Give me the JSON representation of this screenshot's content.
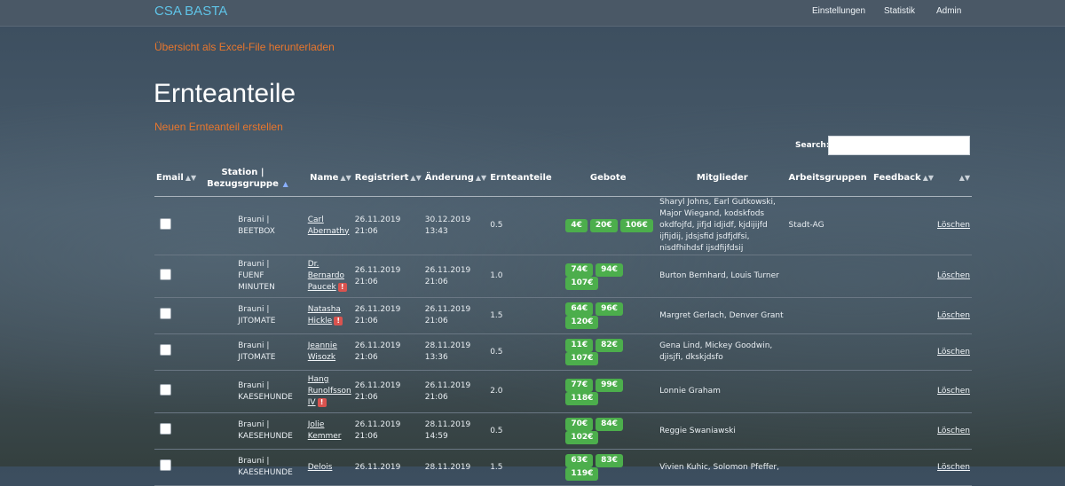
{
  "navbar": {
    "brand": "CSA BASTA",
    "links": [
      "Einstellungen",
      "Statistik",
      "Admin"
    ]
  },
  "excel_link": "Übersicht als Excel-File herunterladen",
  "page_title": "Ernteanteile",
  "create_link": "Neuen Ernteanteil erstellen",
  "search": {
    "label": "Search:",
    "value": ""
  },
  "table": {
    "headers": {
      "email": "Email",
      "station_line1": "Station |",
      "station_line2": "Bezugsgruppe",
      "name": "Name",
      "registriert": "Registriert",
      "aenderung": "Änderung",
      "ernteanteile": "Ernteanteile",
      "gebote": "Gebote",
      "mitglieder": "Mitglieder",
      "arbeitsgruppen": "Arbeitsgruppen",
      "feedback": "Feedback"
    },
    "rows": [
      {
        "station": "Brauni | BEETBOX",
        "name_lines": [
          "Carl",
          "Abernathy"
        ],
        "warning": false,
        "registriert": [
          "26.11.2019",
          "21:06"
        ],
        "aenderung": [
          "30.12.2019",
          "13:43"
        ],
        "ernteanteile": "0.5",
        "gebote": [
          "4€",
          "20€",
          "106€"
        ],
        "mitglieder": "Sharyl Johns, Earl Gutkowski, Major Wiegand, kodskfods okdfojfd, jifjd idjidf, kjdijijfd ijfijdij, jdsjsfid jsdfjdfsi, nisdfhihdsf ijsdfijfdsij",
        "arbeitsgruppen": "Stadt-AG",
        "feedback": "",
        "action": "Löschen"
      },
      {
        "station": "Brauni | FUENF MINUTEN",
        "name_lines": [
          "Dr.",
          "Bernardo",
          "Paucek"
        ],
        "warning": true,
        "registriert": [
          "26.11.2019",
          "21:06"
        ],
        "aenderung": [
          "26.11.2019",
          "21:06"
        ],
        "ernteanteile": "1.0",
        "gebote": [
          "74€",
          "94€",
          "107€"
        ],
        "mitglieder": "Burton Bernhard, Louis Turner",
        "arbeitsgruppen": "",
        "feedback": "",
        "action": "Löschen"
      },
      {
        "station": "Brauni | JITOMATE",
        "name_lines": [
          "Natasha",
          "Hickle"
        ],
        "warning": true,
        "registriert": [
          "26.11.2019",
          "21:06"
        ],
        "aenderung": [
          "26.11.2019",
          "21:06"
        ],
        "ernteanteile": "1.5",
        "gebote": [
          "64€",
          "96€",
          "120€"
        ],
        "mitglieder": "Margret Gerlach, Denver Grant",
        "arbeitsgruppen": "",
        "feedback": "",
        "action": "Löschen"
      },
      {
        "station": "Brauni | JITOMATE",
        "name_lines": [
          "Jeannie",
          "Wisozk"
        ],
        "warning": false,
        "registriert": [
          "26.11.2019",
          "21:06"
        ],
        "aenderung": [
          "28.11.2019",
          "13:36"
        ],
        "ernteanteile": "0.5",
        "gebote": [
          "11€",
          "82€",
          "107€"
        ],
        "mitglieder": "Gena Lind, Mickey Goodwin, djisjfi, dkskjdsfo",
        "arbeitsgruppen": "",
        "feedback": "",
        "action": "Löschen"
      },
      {
        "station": "Brauni | KAESEHUNDE",
        "name_lines": [
          "Hang",
          "Runolfsson",
          "IV"
        ],
        "warning": true,
        "registriert": [
          "26.11.2019",
          "21:06"
        ],
        "aenderung": [
          "26.11.2019",
          "21:06"
        ],
        "ernteanteile": "2.0",
        "gebote": [
          "77€",
          "99€",
          "118€"
        ],
        "mitglieder": "Lonnie Graham",
        "arbeitsgruppen": "",
        "feedback": "",
        "action": "Löschen"
      },
      {
        "station": "Brauni | KAESEHUNDE",
        "name_lines": [
          "Jolie",
          "Kemmer"
        ],
        "warning": false,
        "registriert": [
          "26.11.2019",
          "21:06"
        ],
        "aenderung": [
          "28.11.2019",
          "14:59"
        ],
        "ernteanteile": "0.5",
        "gebote": [
          "70€",
          "84€",
          "102€"
        ],
        "mitglieder": "Reggie Swaniawski",
        "arbeitsgruppen": "",
        "feedback": "",
        "action": "Löschen"
      },
      {
        "station": "Brauni | KAESEHUNDE",
        "name_lines": [
          "Delois"
        ],
        "warning": false,
        "registriert": [
          "26.11.2019"
        ],
        "aenderung": [
          "28.11.2019"
        ],
        "ernteanteile": "1.5",
        "gebote": [
          "63€",
          "83€",
          "119€"
        ],
        "mitglieder": "Vivien Kuhic, Solomon Pfeffer,",
        "arbeitsgruppen": "",
        "feedback": "",
        "action": "Löschen"
      }
    ]
  }
}
